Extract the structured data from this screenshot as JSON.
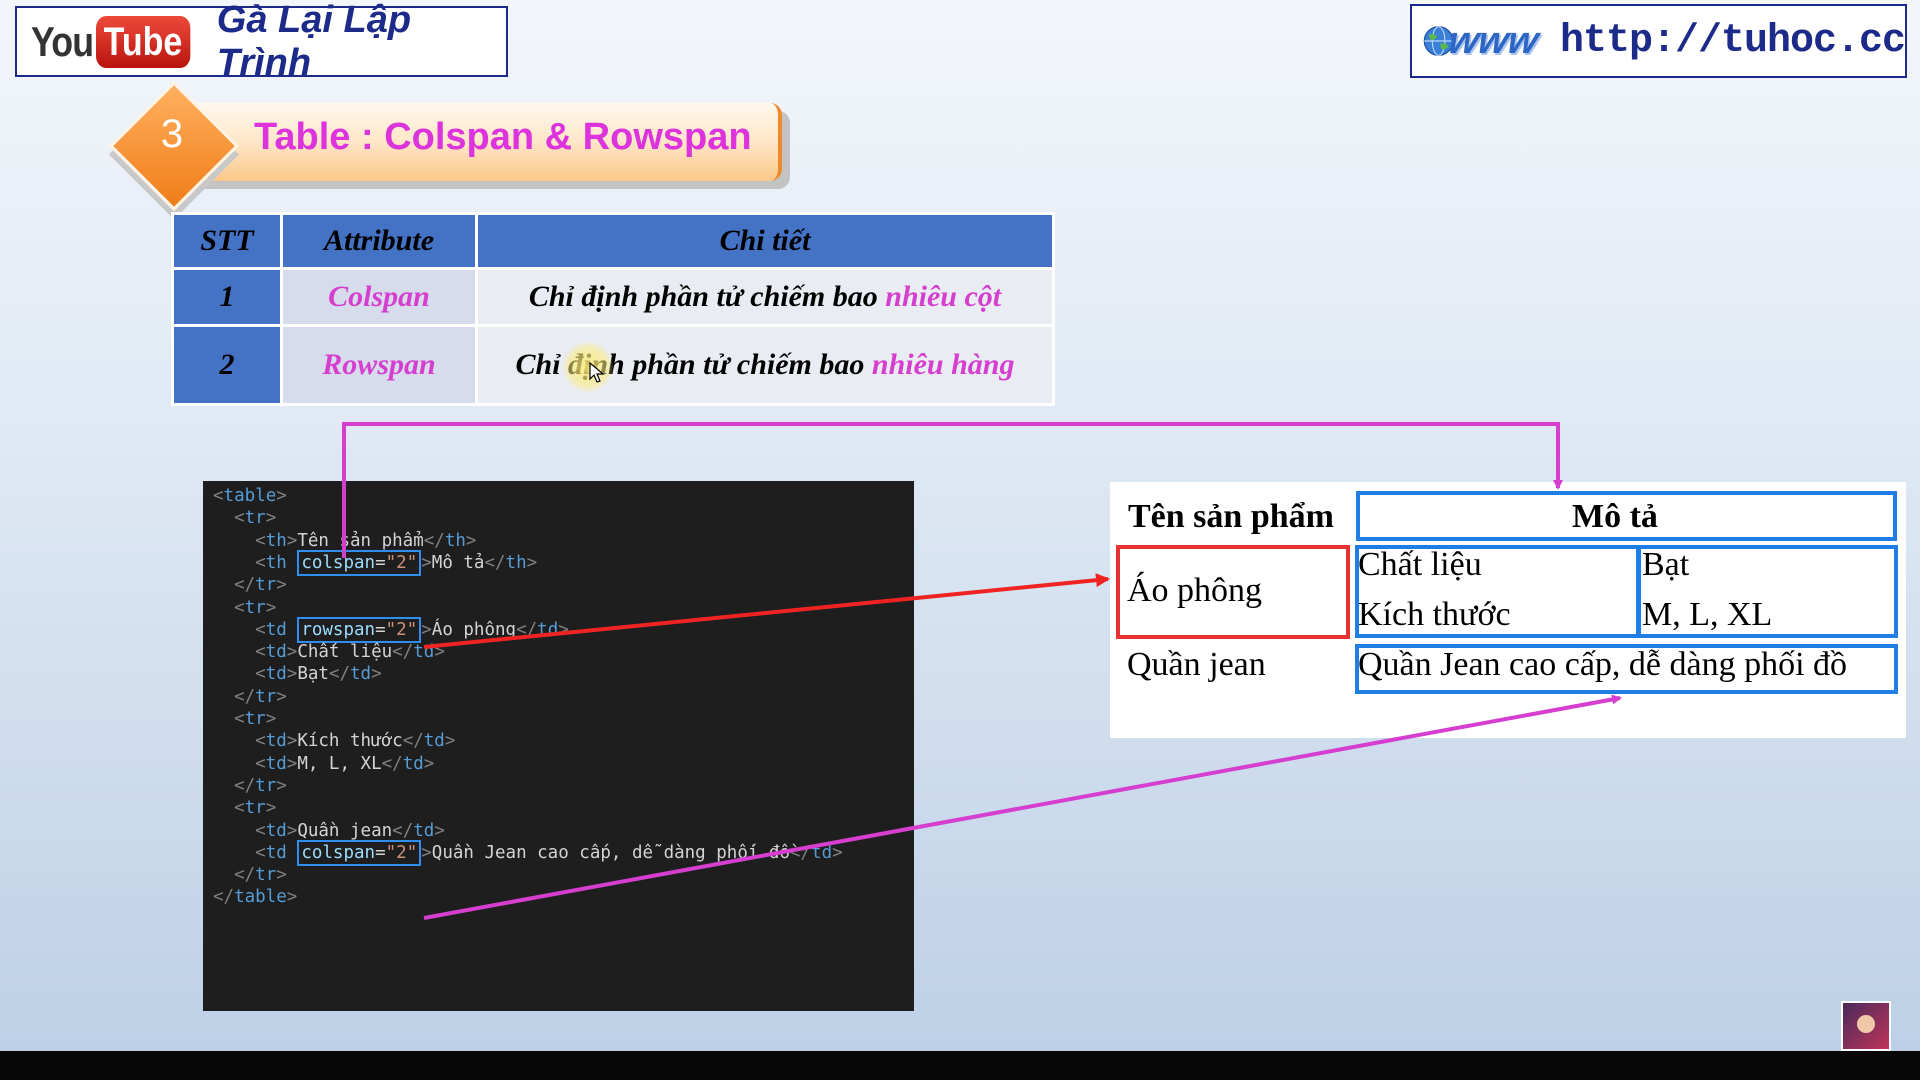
{
  "header": {
    "youtube_logo": {
      "you": "You",
      "tube": "Tube"
    },
    "channel_name": "Gà Lại Lập Trình",
    "www_logo": "www",
    "url": "http://tuhoc.cc"
  },
  "section": {
    "number": "3",
    "title": "Table : Colspan & Rowspan"
  },
  "attr_table": {
    "headers": [
      "STT",
      "Attribute",
      "Chi tiết"
    ],
    "rows": [
      {
        "stt": "1",
        "attribute": "Colspan",
        "desc_prefix": "Chỉ định phần tử chiếm bao ",
        "desc_highlight": "nhiêu cột"
      },
      {
        "stt": "2",
        "attribute": "Rowspan",
        "desc_prefix": "Chỉ định phần tử chiếm bao ",
        "desc_highlight": "nhiêu hàng"
      }
    ]
  },
  "code": {
    "lines": [
      [
        {
          "c": "ang",
          "t": "<"
        },
        {
          "c": "tag",
          "t": "table"
        },
        {
          "c": "ang",
          "t": ">"
        }
      ],
      [
        {
          "c": "ind",
          "t": "  "
        },
        {
          "c": "ang",
          "t": "<"
        },
        {
          "c": "tag",
          "t": "tr"
        },
        {
          "c": "ang",
          "t": ">"
        }
      ],
      [
        {
          "c": "ind",
          "t": "    "
        },
        {
          "c": "ang",
          "t": "<"
        },
        {
          "c": "tag",
          "t": "th"
        },
        {
          "c": "ang",
          "t": ">"
        },
        {
          "c": "txt",
          "t": "Tên sản phẩm"
        },
        {
          "c": "ang",
          "t": "</"
        },
        {
          "c": "tag",
          "t": "th"
        },
        {
          "c": "ang",
          "t": ">"
        }
      ],
      [
        {
          "c": "ind",
          "t": "    "
        },
        {
          "c": "ang",
          "t": "<"
        },
        {
          "c": "tag",
          "t": "th "
        },
        {
          "c": "box",
          "t": [
            {
              "c": "att",
              "t": "colspan"
            },
            {
              "c": "txt",
              "t": "="
            },
            {
              "c": "val",
              "t": "\"2\""
            }
          ]
        },
        {
          "c": "ang",
          "t": ">"
        },
        {
          "c": "txt",
          "t": "Mô tả"
        },
        {
          "c": "ang",
          "t": "</"
        },
        {
          "c": "tag",
          "t": "th"
        },
        {
          "c": "ang",
          "t": ">"
        }
      ],
      [
        {
          "c": "ind",
          "t": "  "
        },
        {
          "c": "ang",
          "t": "</"
        },
        {
          "c": "tag",
          "t": "tr"
        },
        {
          "c": "ang",
          "t": ">"
        }
      ],
      [
        {
          "c": "ind",
          "t": "  "
        },
        {
          "c": "ang",
          "t": "<"
        },
        {
          "c": "tag",
          "t": "tr"
        },
        {
          "c": "ang",
          "t": ">"
        }
      ],
      [
        {
          "c": "ind",
          "t": "    "
        },
        {
          "c": "ang",
          "t": "<"
        },
        {
          "c": "tag",
          "t": "td "
        },
        {
          "c": "box",
          "t": [
            {
              "c": "att",
              "t": "rowspan"
            },
            {
              "c": "txt",
              "t": "="
            },
            {
              "c": "val",
              "t": "\"2\""
            }
          ]
        },
        {
          "c": "ang",
          "t": ">"
        },
        {
          "c": "txt",
          "t": "Áo phông"
        },
        {
          "c": "ang",
          "t": "</"
        },
        {
          "c": "tag",
          "t": "td"
        },
        {
          "c": "ang",
          "t": ">"
        }
      ],
      [
        {
          "c": "ind",
          "t": "    "
        },
        {
          "c": "ang",
          "t": "<"
        },
        {
          "c": "tag",
          "t": "td"
        },
        {
          "c": "ang",
          "t": ">"
        },
        {
          "c": "txt",
          "t": "Chất liệu"
        },
        {
          "c": "ang",
          "t": "</"
        },
        {
          "c": "tag",
          "t": "td"
        },
        {
          "c": "ang",
          "t": ">"
        }
      ],
      [
        {
          "c": "ind",
          "t": "    "
        },
        {
          "c": "ang",
          "t": "<"
        },
        {
          "c": "tag",
          "t": "td"
        },
        {
          "c": "ang",
          "t": ">"
        },
        {
          "c": "txt",
          "t": "Bạt"
        },
        {
          "c": "ang",
          "t": "</"
        },
        {
          "c": "tag",
          "t": "td"
        },
        {
          "c": "ang",
          "t": ">"
        }
      ],
      [
        {
          "c": "ind",
          "t": "  "
        },
        {
          "c": "ang",
          "t": "</"
        },
        {
          "c": "tag",
          "t": "tr"
        },
        {
          "c": "ang",
          "t": ">"
        }
      ],
      [
        {
          "c": "ind",
          "t": "  "
        },
        {
          "c": "ang",
          "t": "<"
        },
        {
          "c": "tag",
          "t": "tr"
        },
        {
          "c": "ang",
          "t": ">"
        }
      ],
      [
        {
          "c": "ind",
          "t": "    "
        },
        {
          "c": "ang",
          "t": "<"
        },
        {
          "c": "tag",
          "t": "td"
        },
        {
          "c": "ang",
          "t": ">"
        },
        {
          "c": "txt",
          "t": "Kích thước"
        },
        {
          "c": "ang",
          "t": "</"
        },
        {
          "c": "tag",
          "t": "td"
        },
        {
          "c": "ang",
          "t": ">"
        }
      ],
      [
        {
          "c": "ind",
          "t": "    "
        },
        {
          "c": "ang",
          "t": "<"
        },
        {
          "c": "tag",
          "t": "td"
        },
        {
          "c": "ang",
          "t": ">"
        },
        {
          "c": "txt",
          "t": "M, L, XL"
        },
        {
          "c": "ang",
          "t": "</"
        },
        {
          "c": "tag",
          "t": "td"
        },
        {
          "c": "ang",
          "t": ">"
        }
      ],
      [
        {
          "c": "ind",
          "t": "  "
        },
        {
          "c": "ang",
          "t": "</"
        },
        {
          "c": "tag",
          "t": "tr"
        },
        {
          "c": "ang",
          "t": ">"
        }
      ],
      [
        {
          "c": "ind",
          "t": "  "
        },
        {
          "c": "ang",
          "t": "<"
        },
        {
          "c": "tag",
          "t": "tr"
        },
        {
          "c": "ang",
          "t": ">"
        }
      ],
      [
        {
          "c": "ind",
          "t": "    "
        },
        {
          "c": "ang",
          "t": "<"
        },
        {
          "c": "tag",
          "t": "td"
        },
        {
          "c": "ang",
          "t": ">"
        },
        {
          "c": "txt",
          "t": "Quần jean"
        },
        {
          "c": "ang",
          "t": "</"
        },
        {
          "c": "tag",
          "t": "td"
        },
        {
          "c": "ang",
          "t": ">"
        }
      ],
      [
        {
          "c": "ind",
          "t": "    "
        },
        {
          "c": "ang",
          "t": "<"
        },
        {
          "c": "tag",
          "t": "td "
        },
        {
          "c": "box",
          "t": [
            {
              "c": "att",
              "t": "colspan"
            },
            {
              "c": "txt",
              "t": "="
            },
            {
              "c": "val",
              "t": "\"2\""
            }
          ]
        },
        {
          "c": "ang",
          "t": ">"
        },
        {
          "c": "txt",
          "t": "Quần Jean cao cấp, dễ dàng phối đồ"
        },
        {
          "c": "ang",
          "t": "</"
        },
        {
          "c": "tag",
          "t": "td"
        },
        {
          "c": "ang",
          "t": ">"
        }
      ],
      [
        {
          "c": "ind",
          "t": "  "
        },
        {
          "c": "ang",
          "t": "</"
        },
        {
          "c": "tag",
          "t": "tr"
        },
        {
          "c": "ang",
          "t": ">"
        }
      ],
      [
        {
          "c": "ang",
          "t": "</"
        },
        {
          "c": "tag",
          "t": "table"
        },
        {
          "c": "ang",
          "t": ">"
        }
      ]
    ]
  },
  "rendered_table": {
    "header_product": "Tên sản phẩm",
    "header_desc": "Mô tả",
    "ao_phong": "Áo phông",
    "chat_lieu": "Chất liệu",
    "kich_thuoc": "Kích thước",
    "bat": "Bạt",
    "sizes": "M, L, XL",
    "quan_jean": "Quần jean",
    "quan_jean_desc": "Quần Jean cao cấp, dễ dàng phối đồ"
  },
  "colors": {
    "accent_magenta": "#d63ed0",
    "arrow_red": "#f02323",
    "highlight_blue": "#1f7de6",
    "table_header_blue": "#4472c4"
  }
}
